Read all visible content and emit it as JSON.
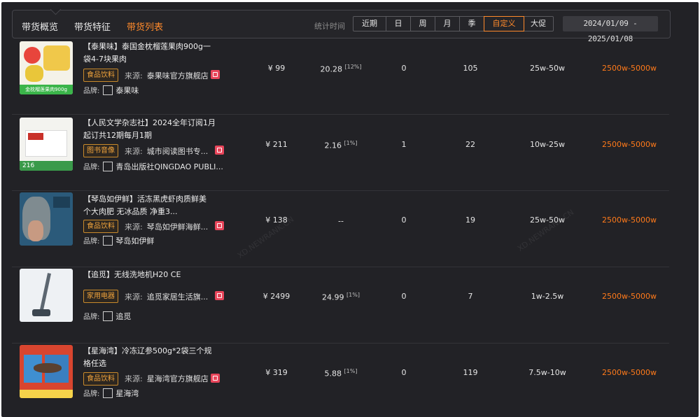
{
  "tabs": [
    {
      "label": "带货概览",
      "active": false
    },
    {
      "label": "带货特征",
      "active": false
    },
    {
      "label": "带货列表",
      "active": true
    }
  ],
  "filter": {
    "time_label": "统计时间",
    "periods": [
      {
        "label": "近期",
        "active": false
      },
      {
        "label": "日",
        "active": false
      },
      {
        "label": "周",
        "active": false
      },
      {
        "label": "月",
        "active": false
      },
      {
        "label": "季",
        "active": false
      },
      {
        "label": "自定义",
        "active": true
      },
      {
        "label": "大促",
        "active": false
      }
    ],
    "date_range": "2024/01/09 - 2025/01/08"
  },
  "labels": {
    "source": "来源:",
    "brand": "品牌:"
  },
  "products": [
    {
      "title": "【泰果味】泰国金枕榴莲果肉900g一袋4-7块果肉",
      "category": "食品饮料",
      "source": "泰果味官方旗舰店",
      "brand": "泰果味",
      "price": "¥ 99",
      "commission": "20.28",
      "commission_rate": "[12%]",
      "col3": "0",
      "col4": "105",
      "sales_range": "25w-50w",
      "gmv_range": "2500w-5000w",
      "thumb_text": "金枕榴莲果肉900g",
      "thumb_color": "#3bb54a"
    },
    {
      "title": "【人民文学杂志社】2024全年订阅1月起订共12期每月1期",
      "category": "图书音像",
      "source": "城市阅读图书专...",
      "brand": "青岛出版社QINGDAO PUBLI...",
      "price": "¥ 211",
      "commission": "2.16",
      "commission_rate": "[1%]",
      "col3": "1",
      "col4": "22",
      "sales_range": "10w-25w",
      "gmv_range": "2500w-5000w",
      "thumb_text": "216",
      "thumb_color": "#3a9a4a"
    },
    {
      "title": "【琴岛如伊鲜】活冻黑虎虾肉质鲜美 个大肉肥 无冰品质 净重3...",
      "category": "食品饮料",
      "source": "琴岛如伊鲜海鲜...",
      "brand": "琴岛如伊鲜",
      "price": "¥ 138",
      "commission": "--",
      "commission_rate": "",
      "col3": "0",
      "col4": "19",
      "sales_range": "25w-50w",
      "gmv_range": "2500w-5000w",
      "thumb_text": "",
      "thumb_color": "#2b5a7a"
    },
    {
      "title": "【追觅】无线洗地机H20 CE",
      "category": "家用电器",
      "source": "追觅家居生活旗...",
      "brand": "追觅",
      "price": "¥ 2499",
      "commission": "24.99",
      "commission_rate": "[1%]",
      "col3": "0",
      "col4": "7",
      "sales_range": "1w-2.5w",
      "gmv_range": "2500w-5000w",
      "thumb_text": "",
      "thumb_color": "#e9edf1"
    },
    {
      "title": "【星海湾】冷冻辽参500g*2袋三个规格任选",
      "category": "食品饮料",
      "source": "星海湾官方旗舰店",
      "brand": "星海湾",
      "price": "¥ 319",
      "commission": "5.88",
      "commission_rate": "[1%]",
      "col3": "0",
      "col4": "119",
      "sales_range": "7.5w-10w",
      "gmv_range": "2500w-5000w",
      "thumb_text": "",
      "thumb_color": "#d8452f"
    }
  ],
  "watermark": "XD.NEWRANK.CN",
  "colors": {
    "accent": "#ff7a1a",
    "panel_bg": "#222226",
    "tag_border": "#c98a2b",
    "store_icon": "#e8455a"
  }
}
